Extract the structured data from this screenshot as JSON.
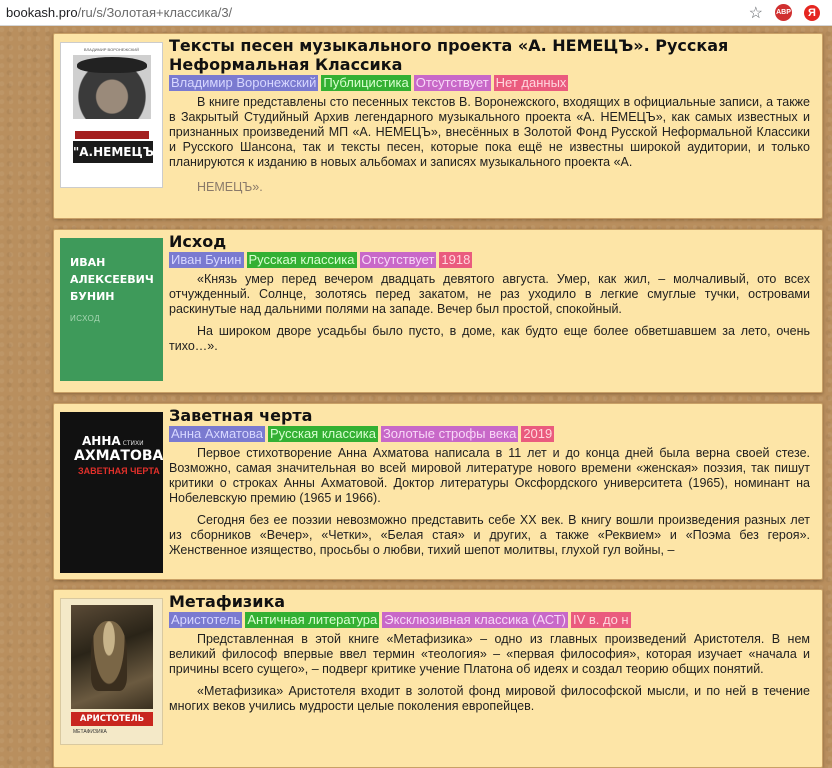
{
  "browser": {
    "url_host": "bookash.pro",
    "url_path": "/ru/s/Золотая+классика/3/",
    "star_icon": "star-icon",
    "abp_label": "ABP",
    "ya_label": "Я"
  },
  "tag_colors": {
    "author": "#7a7ad0",
    "genre": "#33b033",
    "series": "#c868c8",
    "year": "#ea5b7e"
  },
  "books": [
    {
      "title": "Тексты песен музыкального проекта «А. НЕМЕЦЪ». Русская Неформальная Классика",
      "tags": {
        "author": "Владимир Воронежский",
        "genre": "Публицистика",
        "series": "Отсутствует",
        "year": "Нет данных"
      },
      "description": [
        "В книге представлены сто песенных текстов В. Воронежского, входящих в официальные записи, а также в Закрытый Студийный Архив легендарного музыкального проекта «А. НЕМЕЦЪ», как самых известных и признанных произведений МП «А. НЕМЕЦЪ», внесённых в Золотой Фонд Русской Неформальной Классики и Русского Шансона, так и тексты песен, которые пока ещё не известны широкой аудитории, и только планируются к изданию в новых альбомах и записях музыкального проекта «А.",
        "НЕМЕЦЪ»."
      ],
      "cover": {
        "logo": "\"А.НЕМЕЦЪ\""
      }
    },
    {
      "title": "Исход",
      "tags": {
        "author": "Иван Бунин",
        "genre": "Русская классика",
        "series": "Отсутствует",
        "year": "1918"
      },
      "description": [
        "«Князь умер перед вечером двадцать девятого августа. Умер, как жил, – молчаливый, ото всех отчужденный. Солнце, золотясь перед закатом, не раз уходило в легкие смуглые тучки, островами раскинутые над дальними полями на западе. Вечер был простой, спокойный.",
        "На широком дворе усадьбы было пусто, в доме, как будто еще более обветшавшем за лето, очень тихо…»."
      ],
      "cover": {
        "author_line1": "ИВАН",
        "author_line2": "АЛЕКСЕЕВИЧ",
        "author_line3": "БУНИН",
        "title": "ИСХОД"
      }
    },
    {
      "title": "Заветная черта",
      "tags": {
        "author": "Анна Ахматова",
        "genre": "Русская классика",
        "series": "Золотые строфы века",
        "year": "2019"
      },
      "description": [
        "Первое стихотворение Анна Ахматова написала в 11 лет и до конца дней была верна своей стезе. Возможно, самая значительная во всей мировой литературе нового времени «женская» поэзия, так пишут критики о строках Анны Ахматовой. Доктор литературы Оксфордского университета (1965), номинант на Нобелевскую премию (1965 и 1966).",
        "Сегодня без ее поэзии невозможно представить себе XX век. В книгу вошли произведения разных лет из сборников «Вечер», «Четки», «Белая стая» и других, а также «Реквием» и «Поэма без героя». Женственное изящество, просьбы о любви, тихий шепот молитвы, глухой гул войны, –"
      ],
      "cover": {
        "first": "АННА",
        "small": "СТИХИ",
        "last": "АХМАТОВА",
        "title": "ЗАВЕТНАЯ ЧЕРТА"
      }
    },
    {
      "title": "Метафизика",
      "tags": {
        "author": "Аристотель",
        "genre": "Античная литература",
        "series": "Эксклюзивная классика (АСТ)",
        "year": "IV в. до н"
      },
      "description": [
        "Представленная в этой книге «Метафизика» – одно из главных произведений Аристотеля. В нем великий философ впервые ввел термин «теология» – «первая философия», которая изучает «начала и причины всего сущего», – подверг критике учение Платона об идеях и создал теорию общих понятий.",
        "«Метафизика» Аристотеля входит в золотой фонд мировой философской мысли, и по ней в течение многих веков учились мудрости целые поколения европейцев."
      ],
      "cover": {
        "name": "АРИСТОТЕЛЬ",
        "sub": "МЕТАФИЗИКА"
      }
    }
  ]
}
